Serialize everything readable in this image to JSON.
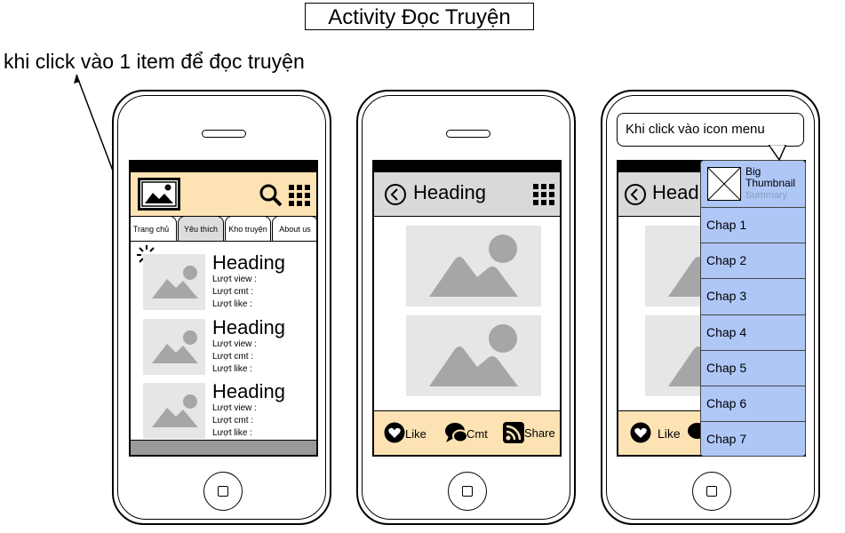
{
  "title": "Activity Đọc Truyện",
  "annotation": "khi click vào 1 item để đọc truyện",
  "phone1": {
    "tabs": [
      "Trang chủ",
      "Yêu thích",
      "Kho truyện",
      "About us"
    ],
    "items": [
      {
        "heading": "Heading",
        "views": "Lượt view :",
        "cmts": "Lượt cmt :",
        "likes": "Lượt like :"
      },
      {
        "heading": "Heading",
        "views": "Lượt view :",
        "cmts": "Lượt cmt :",
        "likes": "Lượt like :"
      },
      {
        "heading": "Heading",
        "views": "Lượt view :",
        "cmts": "Lượt cmt :",
        "likes": "Lượt like :"
      }
    ]
  },
  "phone2": {
    "heading": "Heading",
    "footer": {
      "like": "Like",
      "cmt": "Cmt",
      "share": "Share"
    }
  },
  "phone3": {
    "callout": "Khi click vào icon menu",
    "heading": "Headi",
    "footer_like": "Like",
    "menu": {
      "thumb_title": "Big Thumbnail",
      "thumb_summary": "Summary",
      "chapters": [
        "Chap 1",
        "Chap 2",
        "Chap 3",
        "Chap 4",
        "Chap 5",
        "Chap 6",
        "Chap 7"
      ]
    }
  },
  "colors": {
    "topbar": "#fde3b4",
    "gray_bar": "#d9d9d9",
    "menu": "#aec7f7",
    "placeholder": "#e6e6e6",
    "placeholder_shape": "#a6a6a6"
  }
}
